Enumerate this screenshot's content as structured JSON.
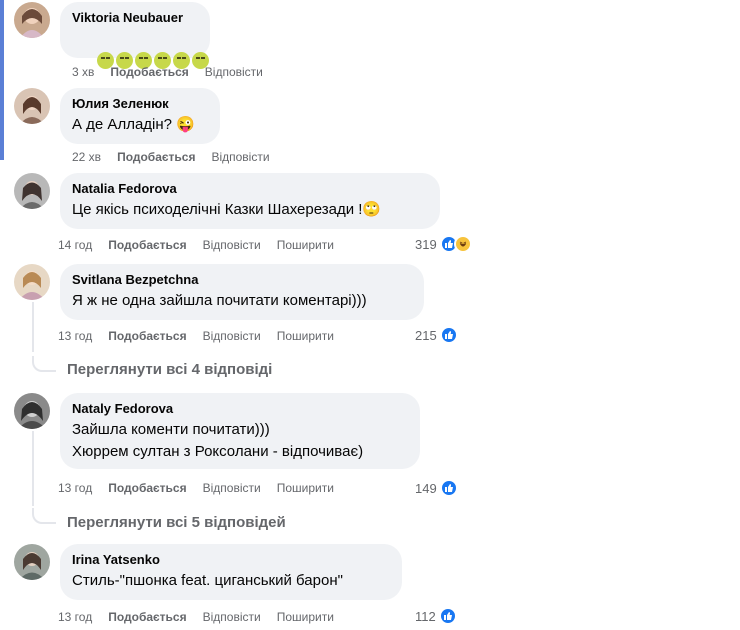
{
  "comments": [
    {
      "author": "Viktoria Neubauer",
      "text": "😖😖😖😖😖😖",
      "time": "3 хв",
      "like": "Подобається",
      "reply": "Відповісти"
    },
    {
      "author": "Юлия Зеленюк",
      "text": "А де Алладін? 😜",
      "time": "22 хв",
      "like": "Подобається",
      "reply": "Відповісти"
    },
    {
      "author": "Natalia Fedorova",
      "text": "Це якісь психоделічні Казки Шахерезади !🙄",
      "time": "14 год",
      "like": "Подобається",
      "reply": "Відповісти",
      "share": "Поширити",
      "reactions": "319"
    },
    {
      "author": "Svitlana Bezpetchna",
      "text": "Я ж не одна зайшла почитати коментарі)))",
      "time": "13 год",
      "like": "Подобається",
      "reply": "Відповісти",
      "share": "Поширити",
      "reactions": "215"
    },
    {
      "author": "Nataly Fedorova",
      "text_line1": "Зайшла коменти почитати)))",
      "text_line2": "Хюррем султан з Роксолани - відпочиває)",
      "time": "13 год",
      "like": "Подобається",
      "reply": "Відповісти",
      "share": "Поширити",
      "reactions": "149"
    },
    {
      "author": "Irina Yatsenko",
      "text": "Стиль-\"пшонка feat. циганський барон\"",
      "time": "13 год",
      "like": "Подобається",
      "reply": "Відповісти",
      "share": "Поширити",
      "reactions": "112"
    }
  ],
  "view_replies": [
    "Переглянути всі 4 відповіді",
    "Переглянути всі 5 відповідей"
  ],
  "colors": {
    "bubble": "#f0f2f5",
    "like_blue": "#1877f2",
    "meta_gray": "#65676b",
    "accent_bar": "#5b7fd6"
  },
  "icons": [
    "like-icon",
    "haha-icon",
    "avatar"
  ]
}
